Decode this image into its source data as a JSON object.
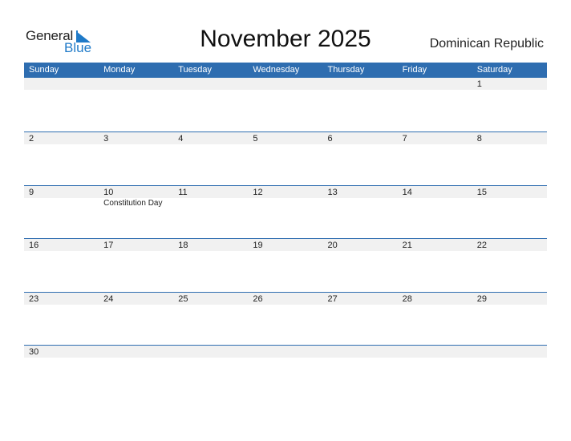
{
  "logo": {
    "text_general": "General",
    "text_blue": "Blue",
    "icon": "triangle-flag-icon"
  },
  "title": "November 2025",
  "country": "Dominican Republic",
  "colors": {
    "header_bg": "#2e6db0",
    "accent": "#1f7ac8",
    "strip_bg": "#f1f1f1"
  },
  "weekdays": [
    "Sunday",
    "Monday",
    "Tuesday",
    "Wednesday",
    "Thursday",
    "Friday",
    "Saturday"
  ],
  "weeks": [
    [
      {
        "d": ""
      },
      {
        "d": ""
      },
      {
        "d": ""
      },
      {
        "d": ""
      },
      {
        "d": ""
      },
      {
        "d": ""
      },
      {
        "d": "1"
      }
    ],
    [
      {
        "d": "2"
      },
      {
        "d": "3"
      },
      {
        "d": "4"
      },
      {
        "d": "5"
      },
      {
        "d": "6"
      },
      {
        "d": "7"
      },
      {
        "d": "8"
      }
    ],
    [
      {
        "d": "9"
      },
      {
        "d": "10",
        "event": "Constitution Day"
      },
      {
        "d": "11"
      },
      {
        "d": "12"
      },
      {
        "d": "13"
      },
      {
        "d": "14"
      },
      {
        "d": "15"
      }
    ],
    [
      {
        "d": "16"
      },
      {
        "d": "17"
      },
      {
        "d": "18"
      },
      {
        "d": "19"
      },
      {
        "d": "20"
      },
      {
        "d": "21"
      },
      {
        "d": "22"
      }
    ],
    [
      {
        "d": "23"
      },
      {
        "d": "24"
      },
      {
        "d": "25"
      },
      {
        "d": "26"
      },
      {
        "d": "27"
      },
      {
        "d": "28"
      },
      {
        "d": "29"
      }
    ],
    [
      {
        "d": "30"
      },
      {
        "d": ""
      },
      {
        "d": ""
      },
      {
        "d": ""
      },
      {
        "d": ""
      },
      {
        "d": ""
      },
      {
        "d": ""
      }
    ]
  ]
}
